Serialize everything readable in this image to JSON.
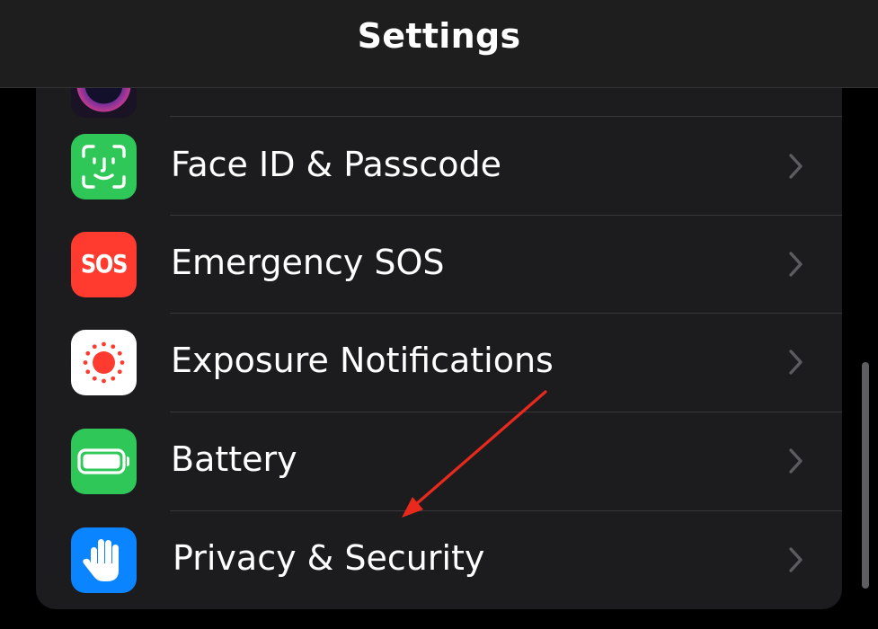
{
  "navbar": {
    "title": "Settings"
  },
  "rows": [
    {
      "label": "Face ID & Passcode",
      "icon": "face-id-icon",
      "icon_color": "#30c759"
    },
    {
      "label": "Emergency SOS",
      "icon": "sos-icon",
      "icon_color": "#ff3b30",
      "icon_text": "SOS"
    },
    {
      "label": "Exposure Notifications",
      "icon": "exposure-notifications-icon",
      "icon_color": "#ffffff"
    },
    {
      "label": "Battery",
      "icon": "battery-icon",
      "icon_color": "#30c759"
    },
    {
      "label": "Privacy & Security",
      "icon": "privacy-hand-icon",
      "icon_color": "#0a84ff"
    }
  ],
  "colors": {
    "background": "#000000",
    "card": "#1c1c1e",
    "separator": "#38383a",
    "chevron": "#5b5b60",
    "annotation_arrow": "#e8291c"
  }
}
